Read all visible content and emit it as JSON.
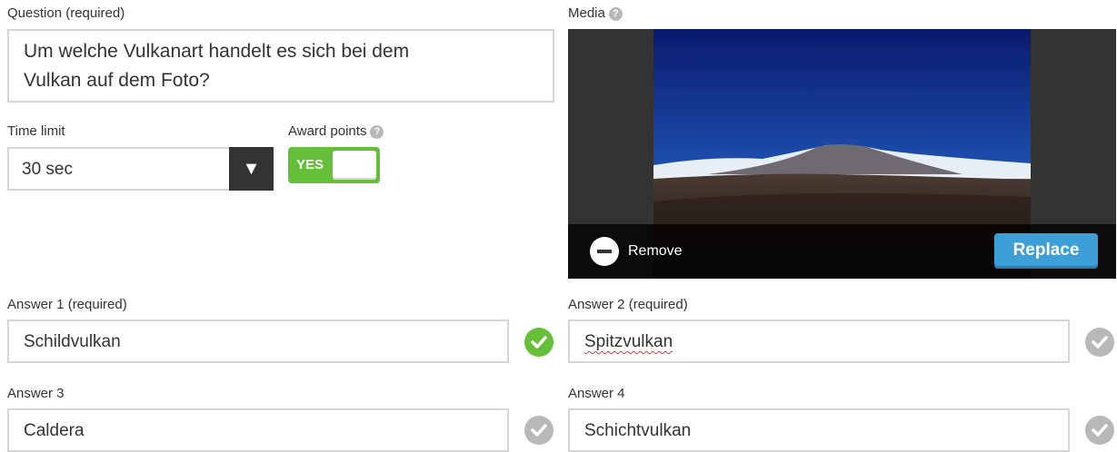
{
  "question": {
    "label": "Question (required)",
    "text": "Um welche Vulkanart handelt es sich bei dem Vulkan auf dem Foto?",
    "text_line1": "Um welche Vulkanart handelt es sich bei dem",
    "text_line2": "Vulkan auf dem Foto?"
  },
  "time_limit": {
    "label": "Time limit",
    "value": "30 sec"
  },
  "award_points": {
    "label": "Award points",
    "toggle_text": "YES",
    "enabled": true
  },
  "help_glyph": "?",
  "media": {
    "label": "Media",
    "remove_label": "Remove",
    "replace_label": "Replace"
  },
  "answers": [
    {
      "label": "Answer 1 (required)",
      "value": "Schildvulkan",
      "correct": true
    },
    {
      "label": "Answer 2 (required)",
      "value": "Spitzvulkan",
      "correct": false
    },
    {
      "label": "Answer 3",
      "value": "Caldera",
      "correct": false
    },
    {
      "label": "Answer 4",
      "value": "Schichtvulkan",
      "correct": false
    }
  ],
  "colors": {
    "accent_green": "#66bf39",
    "replace_blue": "#3d9fd8",
    "dark": "#333333",
    "check_gray": "#b8b8b8"
  },
  "icons": {
    "select_arrow": "dropdown-arrow-icon",
    "help": "question-mark-icon",
    "remove": "minus-circle-icon",
    "check": "checkmark-icon"
  }
}
